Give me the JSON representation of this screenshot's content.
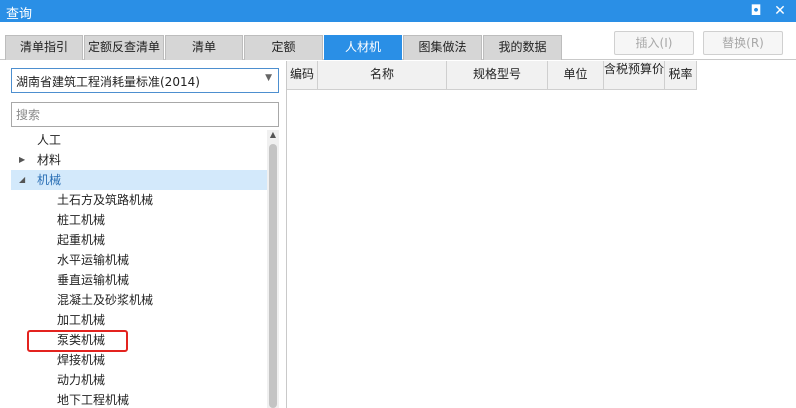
{
  "window": {
    "title": "查询",
    "restore_glyph": "◘",
    "close_glyph": "✕"
  },
  "tabs": [
    {
      "label": "清单指引",
      "active": false
    },
    {
      "label": "定额反查清单",
      "active": false
    },
    {
      "label": "清单",
      "active": false
    },
    {
      "label": "定额",
      "active": false
    },
    {
      "label": "人材机",
      "active": true
    },
    {
      "label": "图集做法",
      "active": false
    },
    {
      "label": "我的数据",
      "active": false
    }
  ],
  "actions": {
    "insert_label": "插入(I)",
    "replace_label": "替换(R)"
  },
  "left": {
    "selected_library": "湖南省建筑工程消耗量标准(2014)",
    "search_placeholder": "搜索",
    "tree": [
      {
        "label": "人工",
        "level": 0,
        "expander": "none",
        "selected": false
      },
      {
        "label": "材料",
        "level": 0,
        "expander": "collapsed",
        "selected": false
      },
      {
        "label": "机械",
        "level": 0,
        "expander": "expanded",
        "selected": true
      },
      {
        "label": "土石方及筑路机械",
        "level": 1,
        "expander": "none",
        "selected": false
      },
      {
        "label": "桩工机械",
        "level": 1,
        "expander": "none",
        "selected": false
      },
      {
        "label": "起重机械",
        "level": 1,
        "expander": "none",
        "selected": false
      },
      {
        "label": "水平运输机械",
        "level": 1,
        "expander": "none",
        "selected": false
      },
      {
        "label": "垂直运输机械",
        "level": 1,
        "expander": "none",
        "selected": false
      },
      {
        "label": "混凝土及砂浆机械",
        "level": 1,
        "expander": "none",
        "selected": false
      },
      {
        "label": "加工机械",
        "level": 1,
        "expander": "none",
        "selected": false
      },
      {
        "label": "泵类机械",
        "level": 1,
        "expander": "none",
        "selected": false,
        "highlighted": true
      },
      {
        "label": "焊接机械",
        "level": 1,
        "expander": "none",
        "selected": false
      },
      {
        "label": "动力机械",
        "level": 1,
        "expander": "none",
        "selected": false
      },
      {
        "label": "地下工程机械",
        "level": 1,
        "expander": "none",
        "selected": false
      }
    ]
  },
  "grid": {
    "columns": [
      {
        "label": "编码"
      },
      {
        "label": "名称"
      },
      {
        "label": "规格型号"
      },
      {
        "label": "单位"
      },
      {
        "label": "含税预算价"
      },
      {
        "label": "税率"
      }
    ],
    "rows": []
  },
  "colors": {
    "accent": "#2a8fe6",
    "selected_row": "#d3e9fb",
    "highlight_box": "#e3231f"
  },
  "icons": {
    "collapsed": "triangle-right-icon",
    "expanded": "triangle-down-icon",
    "dropdown": "caret-down-icon",
    "scroll_up": "scroll-up-arrow-icon"
  }
}
